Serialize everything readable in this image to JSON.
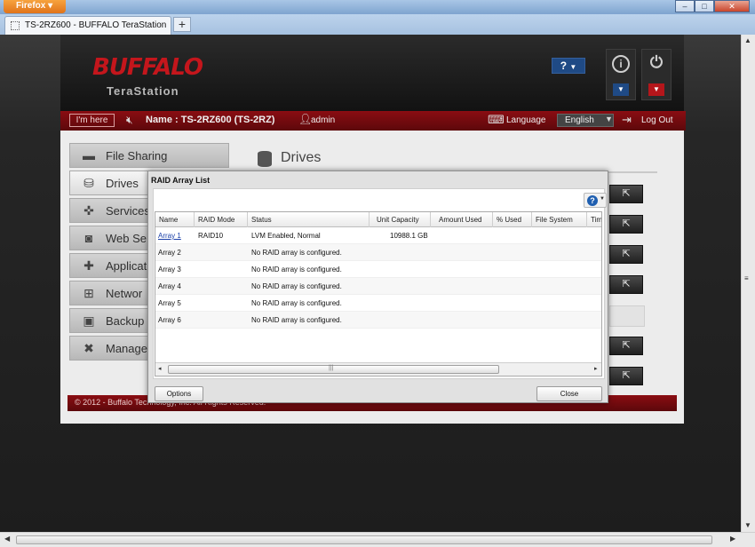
{
  "browser": {
    "menu_label": "Firefox",
    "tab_title": "TS-2RZ600 - BUFFALO TeraStation",
    "new_tab": "+"
  },
  "header": {
    "logo_text": "BUFFALO",
    "product": "TeraStation",
    "help_label": "?",
    "info_glyph": "i",
    "power_glyph": "⏻"
  },
  "topbar": {
    "im_here": "I'm here",
    "device_name": "Name : TS-2RZ600 (TS-2RZ)",
    "username": "admin",
    "language_label": "Language",
    "language_value": "English",
    "logout": "Log Out"
  },
  "sidebar": {
    "items": [
      {
        "label": "File Sharing",
        "icon": "folder-icon"
      },
      {
        "label": "Drives",
        "icon": "drive-icon"
      },
      {
        "label": "Services",
        "icon": "services-icon"
      },
      {
        "label": "Web Se",
        "icon": "web-services-icon"
      },
      {
        "label": "Applicat",
        "icon": "applications-icon"
      },
      {
        "label": "Networ",
        "icon": "network-icon"
      },
      {
        "label": "Backup",
        "icon": "backup-icon"
      },
      {
        "label": "Manage",
        "icon": "tools-icon"
      }
    ]
  },
  "main": {
    "title": "Drives"
  },
  "footer": {
    "copyright": "© 2012 - Buffalo Technology, Inc. All Rights Reserved."
  },
  "dialog": {
    "title": "RAID Array List",
    "help": "?",
    "columns": [
      "Name",
      "RAID Mode",
      "Status",
      "Unit Capacity",
      "Amount Used",
      "% Used",
      "File System",
      "Time"
    ],
    "rows": [
      {
        "name": "Array 1",
        "mode": "RAID10",
        "status": "LVM Enabled, Normal",
        "capacity": "10988.1 GB",
        "link": true
      },
      {
        "name": "Array 2",
        "mode": "",
        "status": "No RAID array is configured.",
        "capacity": "",
        "link": false
      },
      {
        "name": "Array 3",
        "mode": "",
        "status": "No RAID array is configured.",
        "capacity": "",
        "link": false
      },
      {
        "name": "Array 4",
        "mode": "",
        "status": "No RAID array is configured.",
        "capacity": "",
        "link": false
      },
      {
        "name": "Array 5",
        "mode": "",
        "status": "No RAID array is configured.",
        "capacity": "",
        "link": false
      },
      {
        "name": "Array 6",
        "mode": "",
        "status": "No RAID array is configured.",
        "capacity": "",
        "link": false
      }
    ],
    "options_button": "Options",
    "close_button": "Close"
  },
  "colors": {
    "brand_red": "#c4161c",
    "topbar_red": "#7a0b10",
    "link_blue": "#1a3fa8"
  }
}
